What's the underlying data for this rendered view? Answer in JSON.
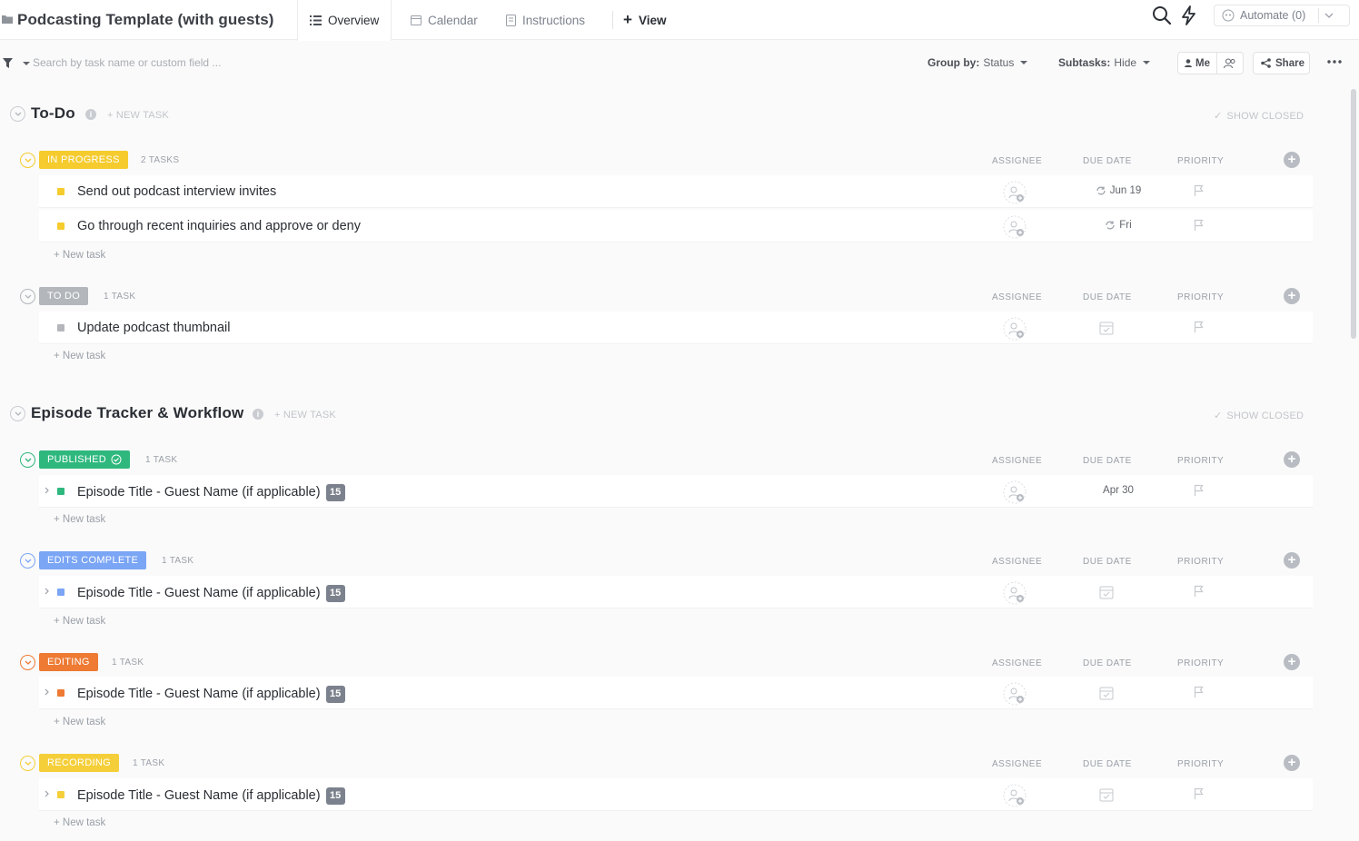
{
  "header": {
    "title": "Podcasting Template (with guests)",
    "tabs": [
      {
        "label": "Overview",
        "icon": "list-icon",
        "active": true
      },
      {
        "label": "Calendar",
        "icon": "calendar-icon",
        "active": false
      },
      {
        "label": "Instructions",
        "icon": "doc-icon",
        "active": false
      }
    ],
    "add_view": "View",
    "automate": "Automate (0)"
  },
  "filter": {
    "search_placeholder": "Search by task name or custom field ...",
    "group_by_label": "Group by:",
    "group_by_value": "Status",
    "subtasks_label": "Subtasks:",
    "subtasks_value": "Hide",
    "me_label": "Me",
    "share_label": "Share"
  },
  "columns": {
    "assignee": "ASSIGNEE",
    "due": "DUE DATE",
    "priority": "PRIORITY"
  },
  "new_task_row": "+ New task",
  "sections": [
    {
      "title": "To-Do",
      "new_task": "+ NEW TASK",
      "show_closed": "SHOW CLOSED",
      "groups": [
        {
          "status": "IN PROGRESS",
          "color": "#f5cb2e",
          "count": "2 TASKS",
          "tasks": [
            {
              "name": "Send out podcast interview invites",
              "due": "Jun 19",
              "subtasks": ""
            },
            {
              "name": "Go through recent inquiries and approve or deny",
              "due": "Fri",
              "subtasks": ""
            }
          ]
        },
        {
          "status": "TO DO",
          "color": "#b3b6bb",
          "count": "1 TASK",
          "tasks": [
            {
              "name": "Update podcast thumbnail",
              "due": "",
              "subtasks": ""
            }
          ]
        }
      ]
    },
    {
      "title": "Episode Tracker & Workflow",
      "new_task": "+ NEW TASK",
      "show_closed": "SHOW CLOSED",
      "groups": [
        {
          "status": "PUBLISHED",
          "color": "#2fb87e",
          "count": "1 TASK",
          "tasks": [
            {
              "name": "Episode Title - Guest Name (if applicable)",
              "due": "Apr 30",
              "subtasks": "15"
            }
          ]
        },
        {
          "status": "EDITS COMPLETE",
          "color": "#7ba5f5",
          "count": "1 TASK",
          "tasks": [
            {
              "name": "Episode Title - Guest Name (if applicable)",
              "due": "",
              "subtasks": "15"
            }
          ]
        },
        {
          "status": "EDITING",
          "color": "#ee7a33",
          "count": "1 TASK",
          "tasks": [
            {
              "name": "Episode Title - Guest Name (if applicable)",
              "due": "",
              "subtasks": "15"
            }
          ]
        },
        {
          "status": "RECORDING",
          "color": "#f5cf3a",
          "count": "1 TASK",
          "tasks": [
            {
              "name": "Episode Title - Guest Name (if applicable)",
              "due": "",
              "subtasks": "15"
            }
          ]
        }
      ]
    }
  ]
}
